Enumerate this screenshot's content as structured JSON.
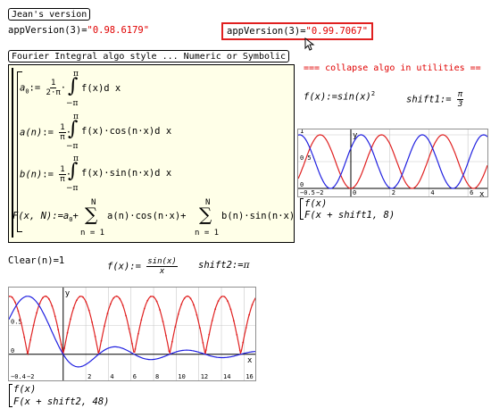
{
  "header": {
    "jeans_label": "Jean's version",
    "left_expr": "appVersion(3)",
    "left_value": "\"0.98.6179\"",
    "right_expr": "appVersion(3)",
    "right_value": "\"0.99.7067\""
  },
  "fourier": {
    "label": "Fourier Integral algo style ... Numeric or Symbolic",
    "collapse_note": "=== collapse algo in utilities ==",
    "a0_lhs": "a",
    "a0_sub": "0",
    "a0_frac_num": "1",
    "a0_frac_den": "2·π",
    "an_lhs": "a(n)",
    "bn_lhs": "b(n)",
    "frac_num": "1",
    "frac_den": "π",
    "int_upper": "π",
    "int_lower": "−π",
    "a0_integrand": "f(x)d x",
    "an_integrand": "f(x)·cos(n·x)d x",
    "bn_integrand": "f(x)·sin(n·x)d x",
    "F_lhs": "F(x, N):=a",
    "F_sub": "0",
    "sum_upper": "N",
    "sum_lower": "n = 1",
    "sum1_term": "a(n)·cos(n·x)+",
    "sum2_term": "b(n)·sin(n·x)",
    "assign": ":="
  },
  "plot1": {
    "f_def": "f(x):=sin(x)",
    "f_exp": "2",
    "shift_name": "shift1",
    "shift_num": "π",
    "shift_den": "3",
    "y_label": "y",
    "x_label": "x",
    "yticks": [
      "1",
      "0.5",
      "0"
    ],
    "xticks": [
      "−0.5",
      "−2",
      "0",
      "2",
      "4",
      "6"
    ],
    "legend1": "f(x)",
    "legend2": "F(x + shift1, 8)",
    "color_f": "#e02020",
    "color_F": "#2020e0",
    "chart_data": {
      "type": "line",
      "xlim": [
        -2.7,
        7
      ],
      "ylim": [
        -0.15,
        1.1
      ],
      "series": [
        {
          "name": "f(x)",
          "expr": "sin(x)^2"
        },
        {
          "name": "F(x + shift1, 8)",
          "expr": "sin(x + π/3)^2"
        }
      ]
    }
  },
  "clear": {
    "expr": "Clear(n)",
    "value": "1",
    "f_def": "f(x):=",
    "f_num": "sin(x)",
    "f_den": "x",
    "shift_name": "shift2",
    "shift_val": "π"
  },
  "plot2": {
    "y_label": "y",
    "x_label": "x",
    "yticks": [
      "0.5",
      "0"
    ],
    "xticks": [
      "−0.4",
      "−2",
      "2",
      "4",
      "6",
      "8",
      "10",
      "12",
      "14",
      "16"
    ],
    "legend1": "f(x)",
    "legend2": "F(x + shift2, 48)",
    "color_f": "#e02020",
    "color_F": "#2020e0",
    "chart_data": {
      "type": "line",
      "xlim": [
        -4.8,
        17
      ],
      "ylim": [
        -0.45,
        1.15
      ],
      "series": [
        {
          "name": "f(x)",
          "expr": "|sin(x)|"
        },
        {
          "name": "F(x + shift2, 48)",
          "expr": "sin(x+π)/(x+π)"
        }
      ]
    }
  }
}
